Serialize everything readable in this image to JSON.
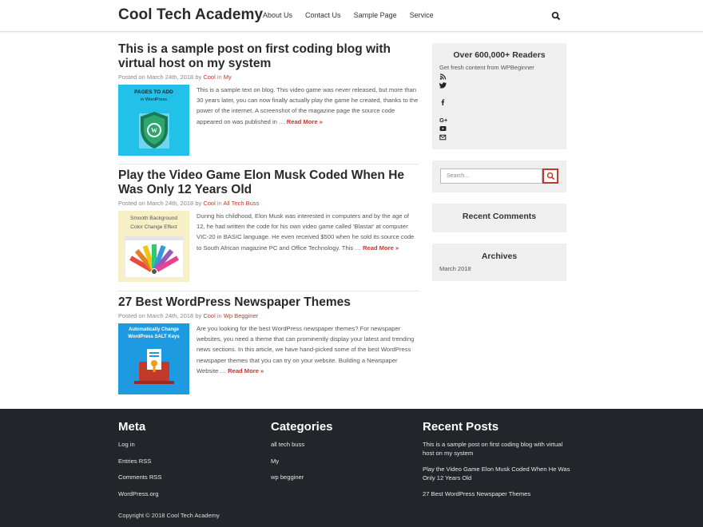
{
  "header": {
    "site_title": "Cool Tech Academy",
    "nav": [
      {
        "label": "About Us"
      },
      {
        "label": "Contact Us"
      },
      {
        "label": "Sample Page"
      },
      {
        "label": "Service"
      }
    ],
    "search_icon": "search-icon"
  },
  "posts": [
    {
      "title": "This is a sample post on first coding blog with virtual host on my system",
      "meta_prefix": "Posted on March 24th, 2018 by ",
      "author": "Cool",
      "in_word": " in ",
      "category": "My",
      "excerpt": "This is a sample text on blog. This video game was never released, but more than 30 years later, you can now finally actually play the game he created, thanks to the power of the internet. A screenshot of the magazine page the source code appeared on was published in …",
      "read_more": "Read More »",
      "thumb_lines": [
        "PAGES TO ADD",
        "in WordPress"
      ],
      "thumb_bg": "#22c1e8"
    },
    {
      "title": "Play the Video Game Elon Musk Coded When He Was Only 12 Years Old",
      "meta_prefix": "Posted on March 24th, 2018 by ",
      "author": "Cool",
      "in_word": " in ",
      "category": "All Tech Buss",
      "excerpt": "During his childhood, Elon Musk was interested in computers and by the age of 12, he had written the code for his own video game called 'Blastar' at computer VIC-20 in BASIC language. He even received $500 when he sold its source code to South African magazine PC and Office Technology. This …",
      "read_more": "Read More »",
      "thumb_lines": [
        "Smooth Background",
        "Color Change Effect"
      ],
      "thumb_bg": "#f7f0c6"
    },
    {
      "title": "27 Best WordPress Newspaper Themes",
      "meta_prefix": "Posted on March 24th, 2018 by ",
      "author": "Cool",
      "in_word": " in ",
      "category": "Wp Begginer",
      "excerpt": "Are you looking for the best WordPress newspaper themes? For newspaper websites, you need a theme that can prominently display your latest and trending news sections. In this article, we have hand-picked some of the best WordPress newspaper themes that you can try on your website. Building a Newspaper Website …",
      "read_more": "Read More »",
      "thumb_lines": [
        "Automatically Change",
        "WordPress SALT Keys"
      ],
      "thumb_bg": "#1e9be0"
    }
  ],
  "sidebar": {
    "readers_title": "Over 600,000+ Readers",
    "readers_sub": "Get fresh content from WPBeginner",
    "social_icons": [
      "rss-icon",
      "twitter-icon",
      "facebook-icon",
      "google-plus-icon",
      "youtube-icon",
      "email-icon"
    ],
    "search_placeholder": "Search...",
    "recent_comments_title": "Recent Comments",
    "archives_title": "Archives",
    "archives": [
      "March 2018"
    ]
  },
  "footer": {
    "meta_title": "Meta",
    "meta_links": [
      "Log in",
      "Entries RSS",
      "Comments RSS",
      "WordPress.org"
    ],
    "categories_title": "Categories",
    "categories": [
      "all tech buss",
      "My",
      "wp begginer"
    ],
    "recent_title": "Recent Posts",
    "recent_posts": [
      "This is a sample post on first coding blog with virtual host on my system",
      "Play the Video Game Elon Musk Coded When He Was Only 12 Years Old",
      "27 Best WordPress Newspaper Themes"
    ],
    "copyright": "Copyright © 2018 Cool Tech Academy"
  },
  "colors": {
    "accent": "#c0392b",
    "footer_bg": "#22252a",
    "widget_bg": "#efefef"
  }
}
